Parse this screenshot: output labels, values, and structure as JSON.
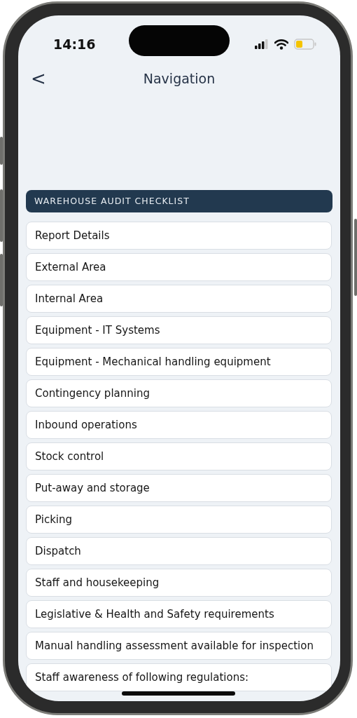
{
  "status_bar": {
    "time": "14:16"
  },
  "nav_bar": {
    "back": "<",
    "title": "Navigation"
  },
  "section": {
    "title": "WAREHOUSE AUDIT CHECKLIST"
  },
  "items": [
    {
      "label": "Report Details"
    },
    {
      "label": "External Area"
    },
    {
      "label": "Internal Area"
    },
    {
      "label": "Equipment - IT Systems"
    },
    {
      "label": "Equipment - Mechanical handling equipment"
    },
    {
      "label": "Contingency planning"
    },
    {
      "label": "Inbound operations"
    },
    {
      "label": "Stock control"
    },
    {
      "label": "Put-away and storage"
    },
    {
      "label": "Picking"
    },
    {
      "label": "Dispatch"
    },
    {
      "label": "Staff and housekeeping"
    },
    {
      "label": "Legislative & Health and Safety requirements"
    },
    {
      "label": "Manual handling assessment available for inspection"
    },
    {
      "label": "Staff awareness of following regulations:"
    }
  ]
}
